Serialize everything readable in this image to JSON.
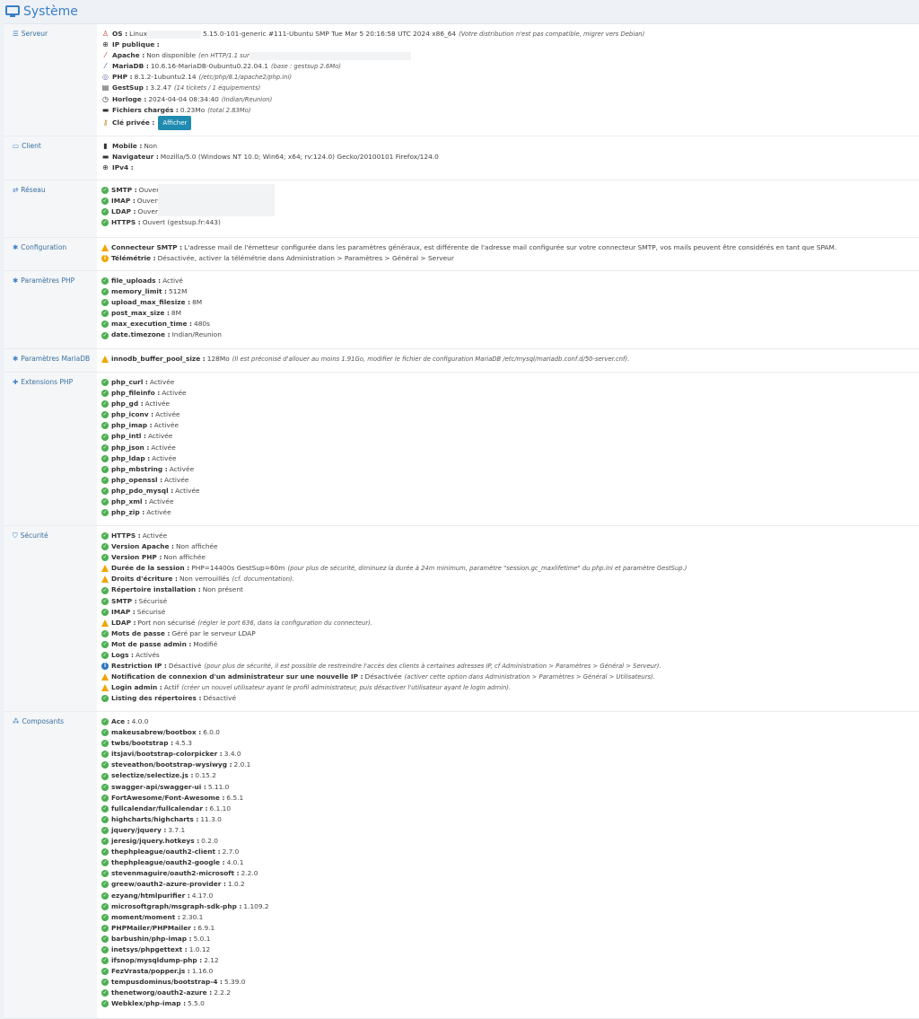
{
  "header": {
    "title": "Système"
  },
  "serveur": {
    "label": "Serveur",
    "os": {
      "k": "OS :",
      "v": "Linux",
      "v2": "5.15.0-101-generic #111-Ubuntu SMP Tue Mar 5 20:16:58 UTC 2024 x86_64",
      "n": "(Votre distribution n'est pas compatible, migrer vers Debian)"
    },
    "ip": {
      "k": "IP publique :"
    },
    "apache": {
      "k": "Apache :",
      "v": "Non disponible",
      "n": "(en HTTP/1.1 sur"
    },
    "mariadb": {
      "k": "MariaDB :",
      "v": "10.6.16-MariaDB-0ubuntu0.22.04.1",
      "n": "(base : gestsup 2.6Mo)"
    },
    "php": {
      "k": "PHP :",
      "v": "8.1.2-1ubuntu2.14",
      "n": "(/etc/php/8.1/apache2/php.ini)"
    },
    "gestsup": {
      "k": "GestSup :",
      "v": "3.2.47",
      "n": "(14 tickets / 1 équipements)"
    },
    "horloge": {
      "k": "Horloge :",
      "v": "2024-04-04 08:34:40",
      "n": "(Indian/Reunion)"
    },
    "fichiers": {
      "k": "Fichiers chargés :",
      "v": "0.23Mo",
      "n": "(total 2.83Mo)"
    },
    "cle": {
      "k": "Clé privée :",
      "btn": "Afficher"
    }
  },
  "client": {
    "label": "Client",
    "mobile": {
      "k": "Mobile :",
      "v": "Non"
    },
    "nav": {
      "k": "Navigateur :",
      "v": "Mozilla/5.0 (Windows NT 10.0; Win64; x64; rv:124.0) Gecko/20100101 Firefox/124.0"
    },
    "ipv4": {
      "k": "IPv4 :"
    }
  },
  "reseau": {
    "label": "Réseau",
    "items": [
      {
        "k": "SMTP :",
        "v": "Ouvert"
      },
      {
        "k": "IMAP :",
        "v": "Ouvert"
      },
      {
        "k": "LDAP :",
        "v": "Ouvert"
      },
      {
        "k": "HTTPS :",
        "v": "Ouvert (gestsup.fr:443)"
      }
    ]
  },
  "configuration": {
    "label": "Configuration",
    "smtp": {
      "k": "Connecteur SMTP :",
      "v": "L'adresse mail de l'émetteur configurée dans les paramètres généraux, est différente de l'adresse mail configurée sur votre connecteur SMTP, vos mails peuvent être considérés en tant que SPAM."
    },
    "tele": {
      "k": "Télémétrie :",
      "v": "Désactivée, activer la télémétrie dans Administration > Paramètres > Général > Serveur"
    }
  },
  "php_params": {
    "label": "Paramètres PHP",
    "items": [
      {
        "k": "file_uploads :",
        "v": "Activé"
      },
      {
        "k": "memory_limit :",
        "v": "512M"
      },
      {
        "k": "upload_max_filesize :",
        "v": "8M"
      },
      {
        "k": "post_max_size :",
        "v": "8M"
      },
      {
        "k": "max_execution_time :",
        "v": "480s"
      },
      {
        "k": "date.timezone :",
        "v": "Indian/Reunion"
      }
    ]
  },
  "maria_params": {
    "label": "Paramètres MariaDB",
    "item": {
      "k": "innodb_buffer_pool_size :",
      "v": "128Mo",
      "n": "(Il est préconisé d'allouer au moins 1.91Go, modifier le fichier de configuration MariaDB /etc/mysql/mariadb.conf.d/50-server.cnf)."
    }
  },
  "extensions": {
    "label": "Extensions PHP",
    "items": [
      {
        "k": "php_curl :",
        "v": "Activée"
      },
      {
        "k": "php_fileinfo :",
        "v": "Activée"
      },
      {
        "k": "php_gd :",
        "v": "Activée"
      },
      {
        "k": "php_iconv :",
        "v": "Activée"
      },
      {
        "k": "php_imap :",
        "v": "Activée"
      },
      {
        "k": "php_intl :",
        "v": "Activée"
      },
      {
        "k": "php_json :",
        "v": "Activée"
      },
      {
        "k": "php_ldap :",
        "v": "Activée"
      },
      {
        "k": "php_mbstring :",
        "v": "Activée"
      },
      {
        "k": "php_openssl :",
        "v": "Activée"
      },
      {
        "k": "php_pdo_mysql :",
        "v": "Activée"
      },
      {
        "k": "php_xml :",
        "v": "Activée"
      },
      {
        "k": "php_zip :",
        "v": "Activée"
      }
    ]
  },
  "securite": {
    "label": "Sécurité",
    "items": [
      {
        "t": "ok",
        "k": "HTTPS :",
        "v": "Activée"
      },
      {
        "t": "ok",
        "k": "Version Apache :",
        "v": "Non affichée"
      },
      {
        "t": "ok",
        "k": "Version PHP :",
        "v": "Non affichée"
      },
      {
        "t": "warn",
        "k": "Durée de la session :",
        "v": "PHP=14400s GestSup=60m",
        "n": "(pour plus de sécurité, diminuez la durée à 24m minimum, paramètre \"session.gc_maxlifetime\" du php.ini et paramètre GestSup.)"
      },
      {
        "t": "warn",
        "k": "Droits d'écriture :",
        "v": "Non verrouillés",
        "n": "(cf. documentation)."
      },
      {
        "t": "ok",
        "k": "Répertoire installation :",
        "v": "Non présent"
      },
      {
        "t": "ok",
        "k": "SMTP :",
        "v": "Sécurisé"
      },
      {
        "t": "ok",
        "k": "IMAP :",
        "v": "Sécurisé"
      },
      {
        "t": "warn",
        "k": "LDAP :",
        "v": "Port non sécurisé",
        "n": "(régler le port 636, dans la configuration du connecteur)."
      },
      {
        "t": "ok",
        "k": "Mots de passe :",
        "v": "Géré par le serveur LDAP"
      },
      {
        "t": "ok",
        "k": "Mot de passe admin :",
        "v": "Modifié"
      },
      {
        "t": "ok",
        "k": "Logs :",
        "v": "Activés"
      },
      {
        "t": "info",
        "k": "Restriction IP :",
        "v": "Désactivé",
        "n": "(pour plus de sécurité, il est possible de restreindre l'accès des clients à certaines adresses IP, cf Administration > Paramètres > Général > Serveur)."
      },
      {
        "t": "warn",
        "k": "Notification de connexion d'un administrateur sur une nouvelle IP :",
        "v": "Désactivée",
        "n": "(activer cette option dans Administration > Paramètres > Général > Utilisateurs)."
      },
      {
        "t": "warn",
        "k": "Login admin :",
        "v": "Actif",
        "n": "(créer un nouvel utilisateur ayant le profil administrateur, puis désactiver l'utilisateur ayant le login admin)."
      },
      {
        "t": "ok",
        "k": "Listing des répertoires :",
        "v": "Désactivé"
      }
    ]
  },
  "composants": {
    "label": "Composants",
    "items": [
      {
        "k": "Ace :",
        "v": "4.0.0"
      },
      {
        "k": "makeusabrew/bootbox :",
        "v": "6.0.0"
      },
      {
        "k": "twbs/bootstrap :",
        "v": "4.5.3"
      },
      {
        "k": "itsjavi/bootstrap-colorpicker :",
        "v": "3.4.0"
      },
      {
        "k": "steveathon/bootstrap-wysiwyg :",
        "v": "2.0.1"
      },
      {
        "k": "selectize/selectize.js :",
        "v": "0.15.2"
      },
      {
        "k": "swagger-api/swagger-ui :",
        "v": "5.11.0"
      },
      {
        "k": "FortAwesome/Font-Awesome :",
        "v": "6.5.1"
      },
      {
        "k": "fullcalendar/fullcalendar :",
        "v": "6.1.10"
      },
      {
        "k": "highcharts/highcharts :",
        "v": "11.3.0"
      },
      {
        "k": "jquery/jquery :",
        "v": "3.7.1"
      },
      {
        "k": "jeresig/jquery.hotkeys :",
        "v": "0.2.0"
      },
      {
        "k": "thephpleague/oauth2-client :",
        "v": "2.7.0"
      },
      {
        "k": "thephpleague/oauth2-google :",
        "v": "4.0.1"
      },
      {
        "k": "stevenmaguire/oauth2-microsoft :",
        "v": "2.2.0"
      },
      {
        "k": "greew/oauth2-azure-provider :",
        "v": "1.0.2"
      },
      {
        "k": "ezyang/htmlpurifier :",
        "v": "4.17.0"
      },
      {
        "k": "microsoftgraph/msgraph-sdk-php :",
        "v": "1.109.2"
      },
      {
        "k": "moment/moment :",
        "v": "2.30.1"
      },
      {
        "k": "PHPMailer/PHPMailer :",
        "v": "6.9.1"
      },
      {
        "k": "barbushin/php-imap :",
        "v": "5.0.1"
      },
      {
        "k": "inetsys/phpgettext :",
        "v": "1.0.12"
      },
      {
        "k": "ifsnop/mysqldump-php :",
        "v": "2.12"
      },
      {
        "k": "FezVrasta/popper.js :",
        "v": "1.16.0"
      },
      {
        "k": "tempusdominus/bootstrap-4 :",
        "v": "5.39.0"
      },
      {
        "k": "thenetworg/oauth2-azure :",
        "v": "2.2.2"
      },
      {
        "k": "Webklex/php-imap :",
        "v": "5.5.0"
      }
    ]
  }
}
